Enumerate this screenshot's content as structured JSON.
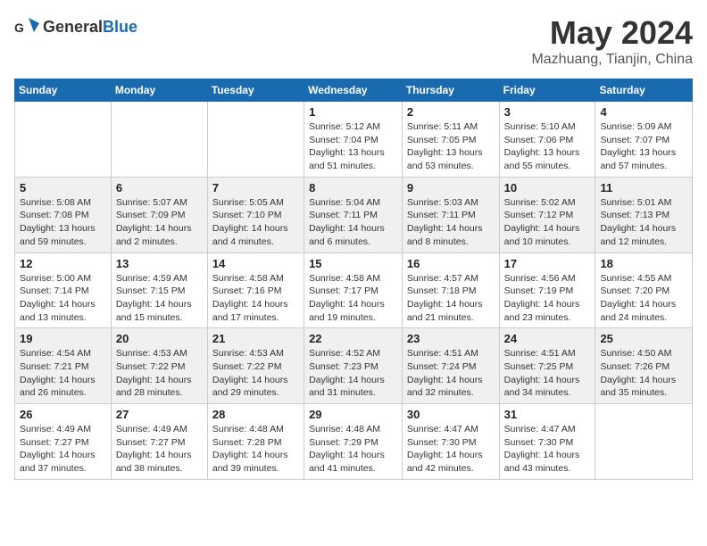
{
  "header": {
    "logo_general": "General",
    "logo_blue": "Blue",
    "month": "May 2024",
    "location": "Mazhuang, Tianjin, China"
  },
  "weekdays": [
    "Sunday",
    "Monday",
    "Tuesday",
    "Wednesday",
    "Thursday",
    "Friday",
    "Saturday"
  ],
  "weeks": [
    [
      {
        "day": "",
        "sunrise": "",
        "sunset": "",
        "daylight": ""
      },
      {
        "day": "",
        "sunrise": "",
        "sunset": "",
        "daylight": ""
      },
      {
        "day": "",
        "sunrise": "",
        "sunset": "",
        "daylight": ""
      },
      {
        "day": "1",
        "sunrise": "Sunrise: 5:12 AM",
        "sunset": "Sunset: 7:04 PM",
        "daylight": "Daylight: 13 hours and 51 minutes."
      },
      {
        "day": "2",
        "sunrise": "Sunrise: 5:11 AM",
        "sunset": "Sunset: 7:05 PM",
        "daylight": "Daylight: 13 hours and 53 minutes."
      },
      {
        "day": "3",
        "sunrise": "Sunrise: 5:10 AM",
        "sunset": "Sunset: 7:06 PM",
        "daylight": "Daylight: 13 hours and 55 minutes."
      },
      {
        "day": "4",
        "sunrise": "Sunrise: 5:09 AM",
        "sunset": "Sunset: 7:07 PM",
        "daylight": "Daylight: 13 hours and 57 minutes."
      }
    ],
    [
      {
        "day": "5",
        "sunrise": "Sunrise: 5:08 AM",
        "sunset": "Sunset: 7:08 PM",
        "daylight": "Daylight: 13 hours and 59 minutes."
      },
      {
        "day": "6",
        "sunrise": "Sunrise: 5:07 AM",
        "sunset": "Sunset: 7:09 PM",
        "daylight": "Daylight: 14 hours and 2 minutes."
      },
      {
        "day": "7",
        "sunrise": "Sunrise: 5:05 AM",
        "sunset": "Sunset: 7:10 PM",
        "daylight": "Daylight: 14 hours and 4 minutes."
      },
      {
        "day": "8",
        "sunrise": "Sunrise: 5:04 AM",
        "sunset": "Sunset: 7:11 PM",
        "daylight": "Daylight: 14 hours and 6 minutes."
      },
      {
        "day": "9",
        "sunrise": "Sunrise: 5:03 AM",
        "sunset": "Sunset: 7:11 PM",
        "daylight": "Daylight: 14 hours and 8 minutes."
      },
      {
        "day": "10",
        "sunrise": "Sunrise: 5:02 AM",
        "sunset": "Sunset: 7:12 PM",
        "daylight": "Daylight: 14 hours and 10 minutes."
      },
      {
        "day": "11",
        "sunrise": "Sunrise: 5:01 AM",
        "sunset": "Sunset: 7:13 PM",
        "daylight": "Daylight: 14 hours and 12 minutes."
      }
    ],
    [
      {
        "day": "12",
        "sunrise": "Sunrise: 5:00 AM",
        "sunset": "Sunset: 7:14 PM",
        "daylight": "Daylight: 14 hours and 13 minutes."
      },
      {
        "day": "13",
        "sunrise": "Sunrise: 4:59 AM",
        "sunset": "Sunset: 7:15 PM",
        "daylight": "Daylight: 14 hours and 15 minutes."
      },
      {
        "day": "14",
        "sunrise": "Sunrise: 4:58 AM",
        "sunset": "Sunset: 7:16 PM",
        "daylight": "Daylight: 14 hours and 17 minutes."
      },
      {
        "day": "15",
        "sunrise": "Sunrise: 4:58 AM",
        "sunset": "Sunset: 7:17 PM",
        "daylight": "Daylight: 14 hours and 19 minutes."
      },
      {
        "day": "16",
        "sunrise": "Sunrise: 4:57 AM",
        "sunset": "Sunset: 7:18 PM",
        "daylight": "Daylight: 14 hours and 21 minutes."
      },
      {
        "day": "17",
        "sunrise": "Sunrise: 4:56 AM",
        "sunset": "Sunset: 7:19 PM",
        "daylight": "Daylight: 14 hours and 23 minutes."
      },
      {
        "day": "18",
        "sunrise": "Sunrise: 4:55 AM",
        "sunset": "Sunset: 7:20 PM",
        "daylight": "Daylight: 14 hours and 24 minutes."
      }
    ],
    [
      {
        "day": "19",
        "sunrise": "Sunrise: 4:54 AM",
        "sunset": "Sunset: 7:21 PM",
        "daylight": "Daylight: 14 hours and 26 minutes."
      },
      {
        "day": "20",
        "sunrise": "Sunrise: 4:53 AM",
        "sunset": "Sunset: 7:22 PM",
        "daylight": "Daylight: 14 hours and 28 minutes."
      },
      {
        "day": "21",
        "sunrise": "Sunrise: 4:53 AM",
        "sunset": "Sunset: 7:22 PM",
        "daylight": "Daylight: 14 hours and 29 minutes."
      },
      {
        "day": "22",
        "sunrise": "Sunrise: 4:52 AM",
        "sunset": "Sunset: 7:23 PM",
        "daylight": "Daylight: 14 hours and 31 minutes."
      },
      {
        "day": "23",
        "sunrise": "Sunrise: 4:51 AM",
        "sunset": "Sunset: 7:24 PM",
        "daylight": "Daylight: 14 hours and 32 minutes."
      },
      {
        "day": "24",
        "sunrise": "Sunrise: 4:51 AM",
        "sunset": "Sunset: 7:25 PM",
        "daylight": "Daylight: 14 hours and 34 minutes."
      },
      {
        "day": "25",
        "sunrise": "Sunrise: 4:50 AM",
        "sunset": "Sunset: 7:26 PM",
        "daylight": "Daylight: 14 hours and 35 minutes."
      }
    ],
    [
      {
        "day": "26",
        "sunrise": "Sunrise: 4:49 AM",
        "sunset": "Sunset: 7:27 PM",
        "daylight": "Daylight: 14 hours and 37 minutes."
      },
      {
        "day": "27",
        "sunrise": "Sunrise: 4:49 AM",
        "sunset": "Sunset: 7:27 PM",
        "daylight": "Daylight: 14 hours and 38 minutes."
      },
      {
        "day": "28",
        "sunrise": "Sunrise: 4:48 AM",
        "sunset": "Sunset: 7:28 PM",
        "daylight": "Daylight: 14 hours and 39 minutes."
      },
      {
        "day": "29",
        "sunrise": "Sunrise: 4:48 AM",
        "sunset": "Sunset: 7:29 PM",
        "daylight": "Daylight: 14 hours and 41 minutes."
      },
      {
        "day": "30",
        "sunrise": "Sunrise: 4:47 AM",
        "sunset": "Sunset: 7:30 PM",
        "daylight": "Daylight: 14 hours and 42 minutes."
      },
      {
        "day": "31",
        "sunrise": "Sunrise: 4:47 AM",
        "sunset": "Sunset: 7:30 PM",
        "daylight": "Daylight: 14 hours and 43 minutes."
      },
      {
        "day": "",
        "sunrise": "",
        "sunset": "",
        "daylight": ""
      }
    ]
  ]
}
